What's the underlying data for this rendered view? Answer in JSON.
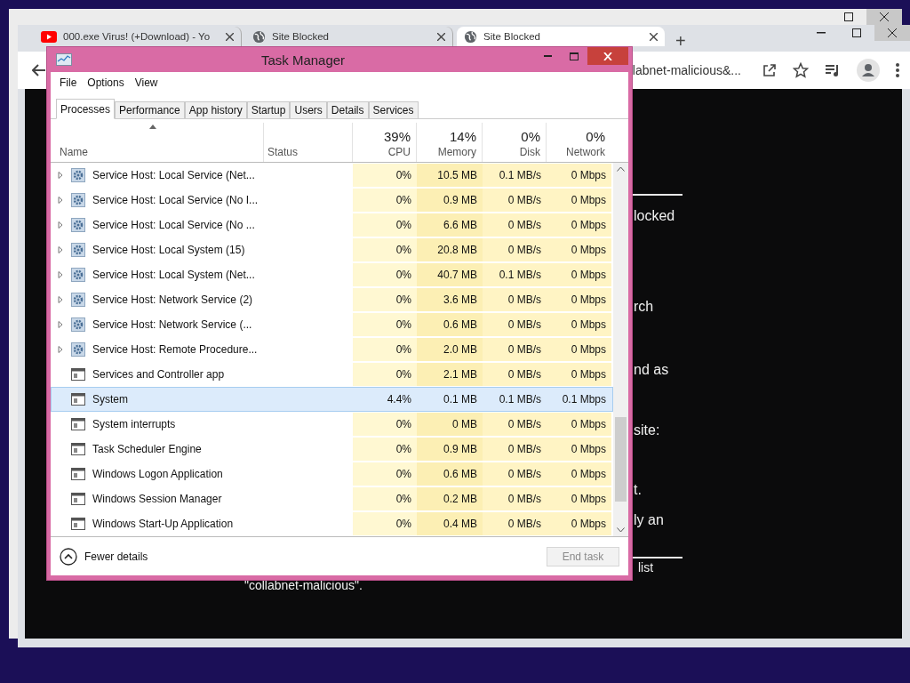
{
  "browser": {
    "tabs": [
      {
        "title": "000.exe Virus! (+Download) - Yo",
        "kind": "video",
        "selected": false
      },
      {
        "title": "Site Blocked",
        "kind": "page",
        "selected": false
      },
      {
        "title": "Site Blocked",
        "kind": "page",
        "selected": true
      }
    ],
    "new_tab": "+",
    "address": "labnet-malicious&...",
    "page": {
      "fragments": [
        {
          "kind": "rule"
        },
        {
          "kind": "text",
          "text": "locked"
        },
        {
          "kind": "text",
          "text": "rch"
        },
        {
          "kind": "text",
          "text": "nd as"
        },
        {
          "kind": "text",
          "text": "site:"
        },
        {
          "kind": "text",
          "text": "t."
        },
        {
          "kind": "text",
          "text": "ly an"
        },
        {
          "kind": "rule"
        },
        {
          "kind": "small",
          "text": "list"
        }
      ],
      "footer_line": "\"collabnet-malicious\"."
    }
  },
  "task_manager": {
    "title": "Task Manager",
    "menu": [
      "File",
      "Options",
      "View"
    ],
    "tabs": [
      {
        "label": "Processes",
        "selected": true
      },
      {
        "label": "Performance",
        "selected": false
      },
      {
        "label": "App history",
        "selected": false
      },
      {
        "label": "Startup",
        "selected": false
      },
      {
        "label": "Users",
        "selected": false
      },
      {
        "label": "Details",
        "selected": false
      },
      {
        "label": "Services",
        "selected": false
      }
    ],
    "columns": [
      {
        "label": "Name"
      },
      {
        "label": "Status"
      },
      {
        "label": "CPU",
        "total": "39%"
      },
      {
        "label": "Memory",
        "total": "14%"
      },
      {
        "label": "Disk",
        "total": "0%"
      },
      {
        "label": "Network",
        "total": "0%"
      }
    ],
    "rows": [
      {
        "kind": "group",
        "name": "Service Host: Local Service (Net...",
        "cpu": "0%",
        "memory": "10.5 MB",
        "disk": "0.1 MB/s",
        "network": "0 Mbps",
        "selected": false
      },
      {
        "kind": "group",
        "name": "Service Host: Local Service (No I...",
        "cpu": "0%",
        "memory": "0.9 MB",
        "disk": "0 MB/s",
        "network": "0 Mbps",
        "selected": false
      },
      {
        "kind": "group",
        "name": "Service Host: Local Service (No ...",
        "cpu": "0%",
        "memory": "6.6 MB",
        "disk": "0 MB/s",
        "network": "0 Mbps",
        "selected": false
      },
      {
        "kind": "group",
        "name": "Service Host: Local System (15)",
        "cpu": "0%",
        "memory": "20.8 MB",
        "disk": "0 MB/s",
        "network": "0 Mbps",
        "selected": false
      },
      {
        "kind": "group",
        "name": "Service Host: Local System (Net...",
        "cpu": "0%",
        "memory": "40.7 MB",
        "disk": "0.1 MB/s",
        "network": "0 Mbps",
        "selected": false
      },
      {
        "kind": "group",
        "name": "Service Host: Network Service (2)",
        "cpu": "0%",
        "memory": "3.6 MB",
        "disk": "0 MB/s",
        "network": "0 Mbps",
        "selected": false
      },
      {
        "kind": "group",
        "name": "Service Host: Network Service (...",
        "cpu": "0%",
        "memory": "0.6 MB",
        "disk": "0 MB/s",
        "network": "0 Mbps",
        "selected": false
      },
      {
        "kind": "group",
        "name": "Service Host: Remote Procedure...",
        "cpu": "0%",
        "memory": "2.0 MB",
        "disk": "0 MB/s",
        "network": "0 Mbps",
        "selected": false
      },
      {
        "kind": "process",
        "name": "Services and Controller app",
        "cpu": "0%",
        "memory": "2.1 MB",
        "disk": "0 MB/s",
        "network": "0 Mbps",
        "selected": false
      },
      {
        "kind": "process",
        "name": "System",
        "cpu": "4.4%",
        "memory": "0.1 MB",
        "disk": "0.1 MB/s",
        "network": "0.1 Mbps",
        "selected": true
      },
      {
        "kind": "process",
        "name": "System interrupts",
        "cpu": "0%",
        "memory": "0 MB",
        "disk": "0 MB/s",
        "network": "0 Mbps",
        "selected": false
      },
      {
        "kind": "process",
        "name": "Task Scheduler Engine",
        "cpu": "0%",
        "memory": "0.9 MB",
        "disk": "0 MB/s",
        "network": "0 Mbps",
        "selected": false
      },
      {
        "kind": "process",
        "name": "Windows Logon Application",
        "cpu": "0%",
        "memory": "0.6 MB",
        "disk": "0 MB/s",
        "network": "0 Mbps",
        "selected": false
      },
      {
        "kind": "process",
        "name": "Windows Session Manager",
        "cpu": "0%",
        "memory": "0.2 MB",
        "disk": "0 MB/s",
        "network": "0 Mbps",
        "selected": false
      },
      {
        "kind": "process",
        "name": "Windows Start-Up Application",
        "cpu": "0%",
        "memory": "0.4 MB",
        "disk": "0 MB/s",
        "network": "0 Mbps",
        "selected": false
      }
    ],
    "fewer_details": "Fewer details",
    "end_task": {
      "label": "End task",
      "disabled": true
    }
  }
}
